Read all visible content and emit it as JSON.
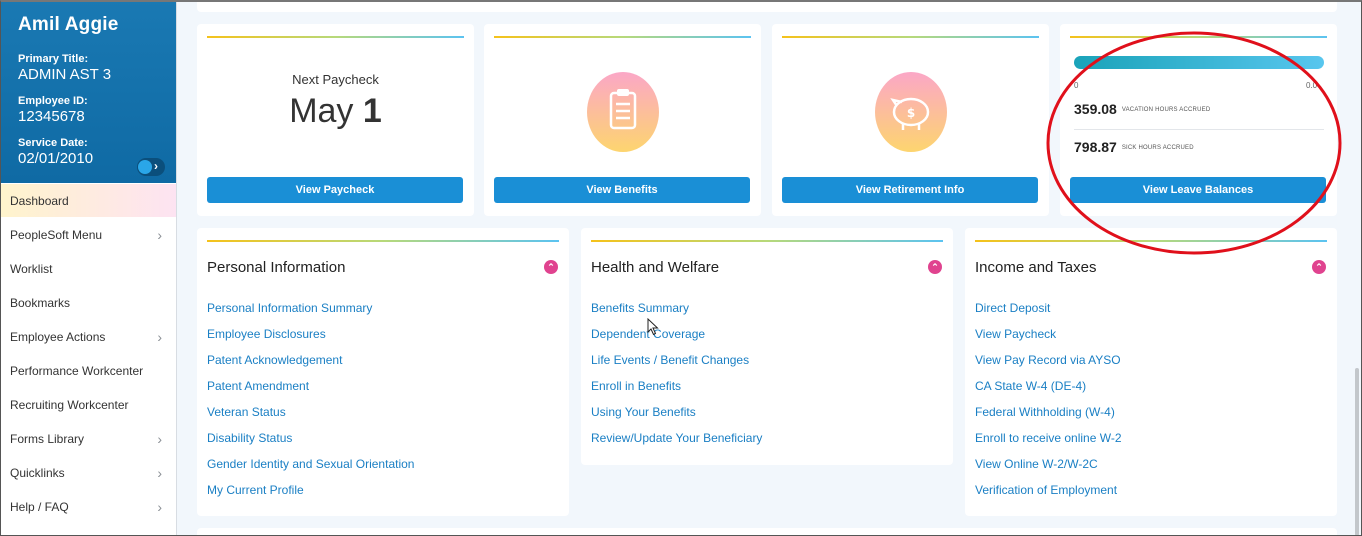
{
  "profile": {
    "name": "Amil Aggie",
    "title_label": "Primary Title:",
    "title_value": "ADMIN AST 3",
    "id_label": "Employee ID:",
    "id_value": "12345678",
    "service_label": "Service Date:",
    "service_value": "02/01/2010"
  },
  "sidebar": {
    "items": [
      {
        "label": "Dashboard",
        "active": true,
        "has_submenu": false
      },
      {
        "label": "PeopleSoft Menu",
        "has_submenu": true
      },
      {
        "label": "Worklist",
        "has_submenu": false
      },
      {
        "label": "Bookmarks",
        "has_submenu": false
      },
      {
        "label": "Employee Actions",
        "has_submenu": true
      },
      {
        "label": "Performance Workcenter",
        "has_submenu": false
      },
      {
        "label": "Recruiting Workcenter",
        "has_submenu": false
      },
      {
        "label": "Forms Library",
        "has_submenu": true
      },
      {
        "label": "Quicklinks",
        "has_submenu": true
      },
      {
        "label": "Help / FAQ",
        "has_submenu": true
      }
    ]
  },
  "cards": {
    "paycheck": {
      "label": "Next Paycheck",
      "month": "May",
      "day": "1",
      "button": "View Paycheck"
    },
    "benefits": {
      "icon": "clipboard-icon",
      "button": "View Benefits"
    },
    "retirement": {
      "icon": "piggy-bank-icon",
      "button": "View Retirement Info"
    },
    "leave": {
      "scale_min": "0",
      "scale_max": "0.0",
      "vacation_hours": "359.08",
      "vacation_label": "VACATION HOURS ACCRUED",
      "sick_hours": "798.87",
      "sick_label": "SICK HOURS ACCRUED",
      "button": "View Leave Balances"
    }
  },
  "sections": {
    "personal": {
      "title": "Personal Information",
      "links": [
        "Personal Information Summary",
        "Employee Disclosures",
        "Patent Acknowledgement",
        "Patent Amendment",
        "Veteran Status",
        "Disability Status",
        "Gender Identity and Sexual Orientation",
        "My Current Profile"
      ]
    },
    "health": {
      "title": "Health and Welfare",
      "links": [
        "Benefits Summary",
        "Dependent Coverage",
        "Life Events / Benefit Changes",
        "Enroll in Benefits",
        "Using Your Benefits",
        "Review/Update Your Beneficiary"
      ]
    },
    "income": {
      "title": "Income and Taxes",
      "links": [
        "Direct Deposit",
        "View Paycheck",
        "View Pay Record via AYSO",
        "CA State W-4 (DE-4)",
        "Federal Withholding (W-4)",
        "Enroll to receive online W-2",
        "View Online W-2/W-2C",
        "Verification of Employment"
      ]
    }
  },
  "colors": {
    "brand_blue": "#1a79b3",
    "button_blue": "#1a8fd6",
    "link_blue": "#1a7fc4",
    "accent_pink": "#e0438f",
    "annotation_red": "#e0101b"
  }
}
